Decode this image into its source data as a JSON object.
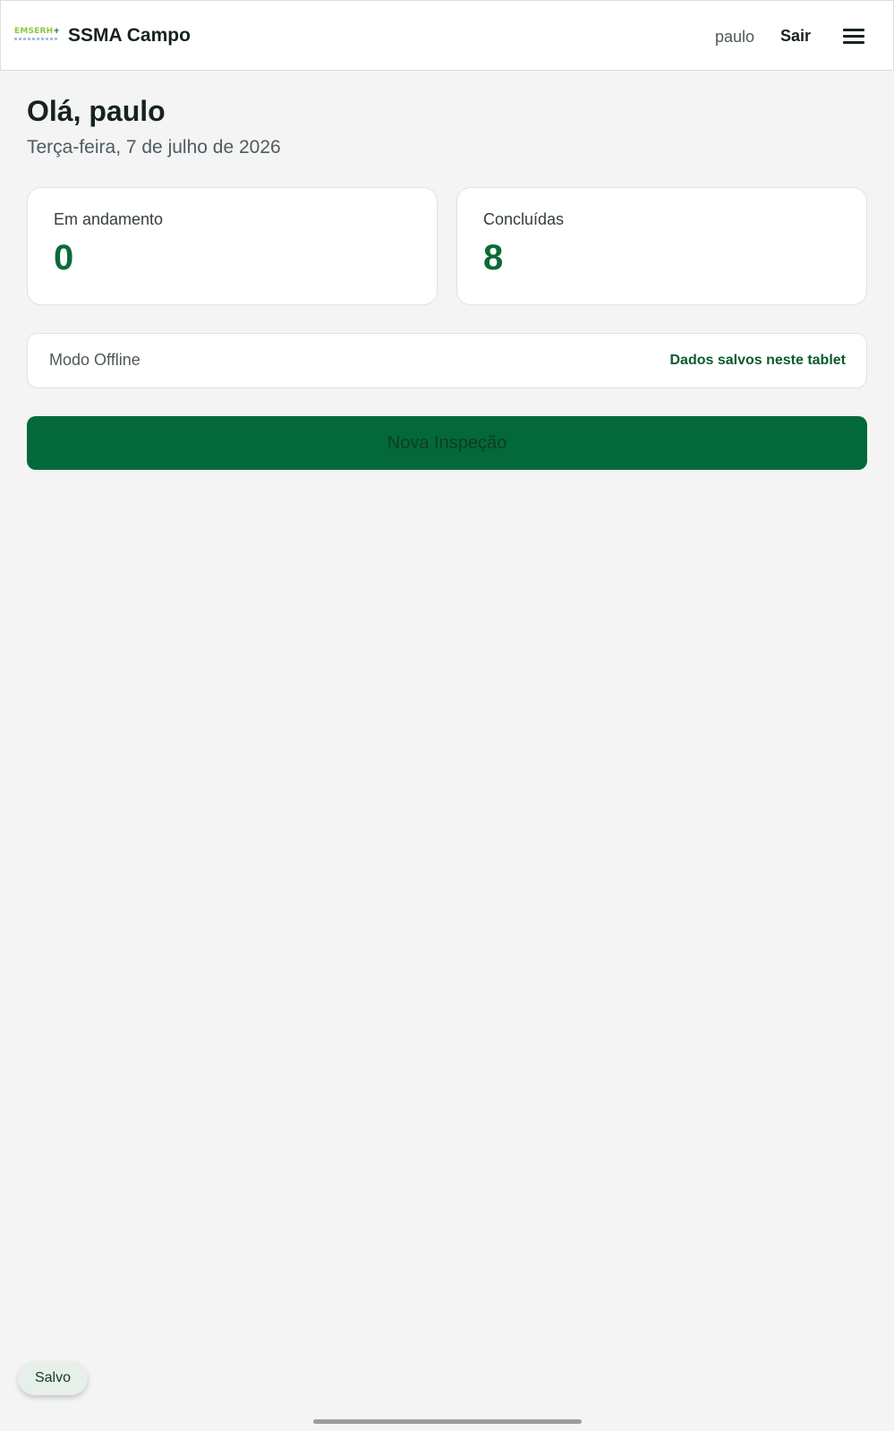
{
  "header": {
    "logo_text": "EMSERH",
    "logo_plus": "+",
    "app_title": "SSMA Campo",
    "username": "paulo",
    "logout_label": "Sair",
    "menu_icon": "hamburger-menu-icon"
  },
  "main": {
    "greeting": "Olá, paulo",
    "date": "Terça-feira, 7 de julho de 2026",
    "stats": [
      {
        "label": "Em andamento",
        "value": "0"
      },
      {
        "label": "Concluídas",
        "value": "8"
      }
    ],
    "offline": {
      "label": "Modo Offline",
      "status": "Dados salvos neste tablet"
    },
    "new_inspection_label": "Nova Inspeção"
  },
  "toast": {
    "text": "Salvo"
  },
  "colors": {
    "brand_green": "#03693a",
    "accent_green": "#0b6b36",
    "logo_lime": "#8cc63f",
    "background": "#f3f4f3"
  }
}
